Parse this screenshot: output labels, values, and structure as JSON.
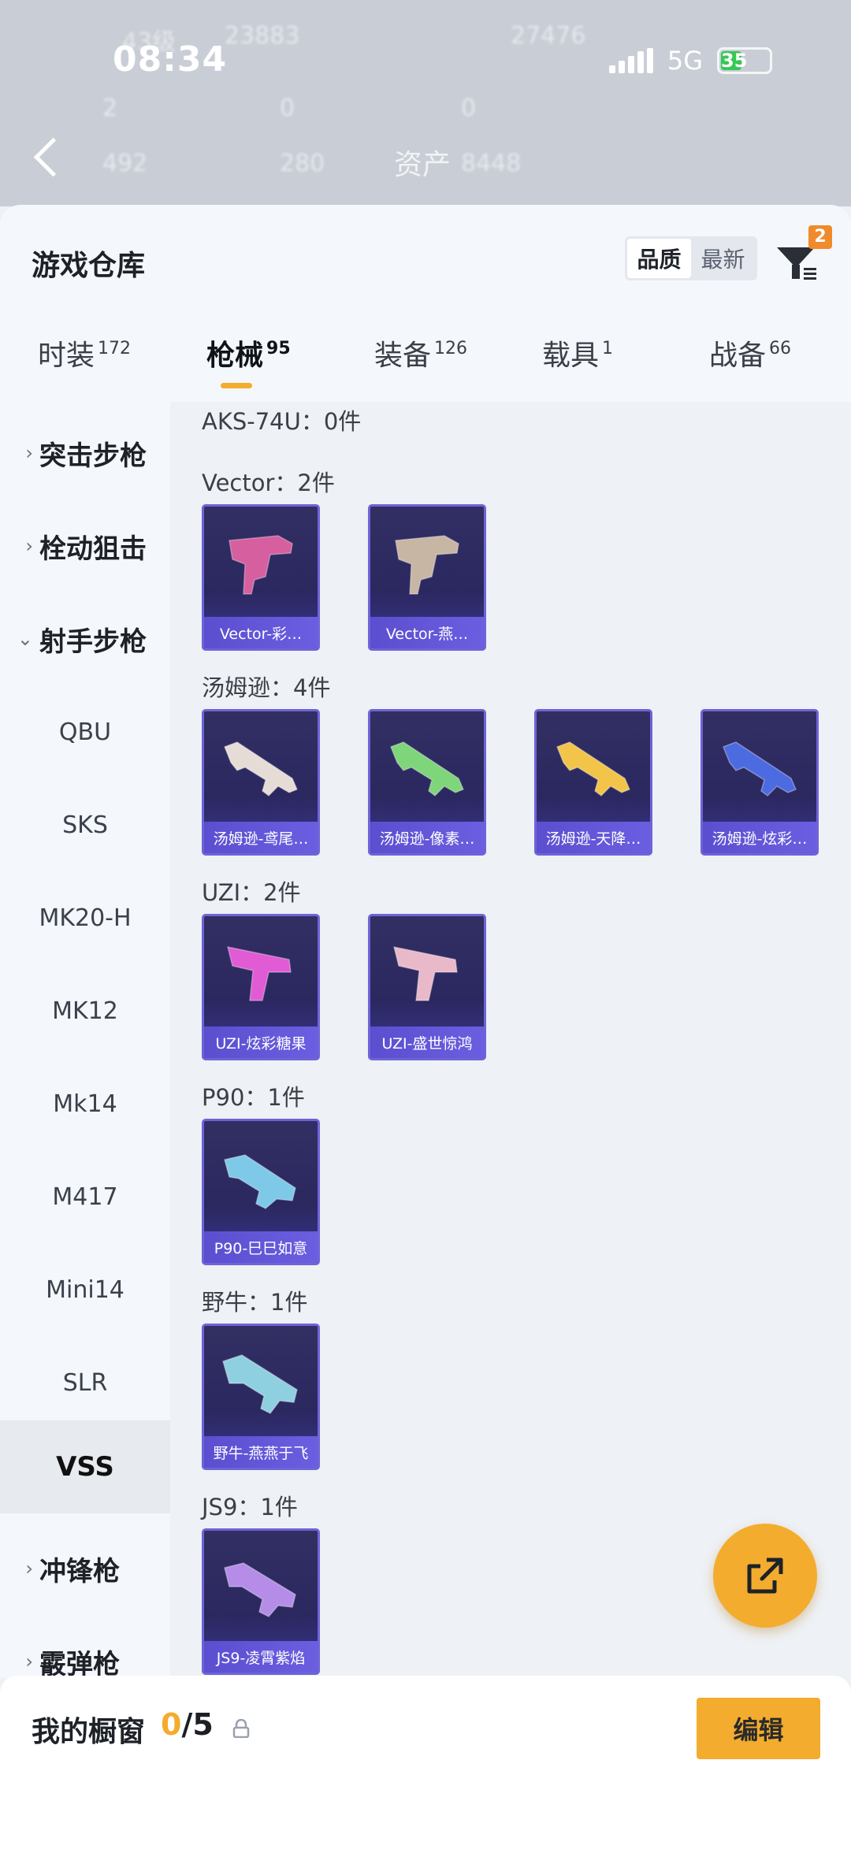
{
  "status_bar": {
    "time": "08:34",
    "network": "5G",
    "battery": "35"
  },
  "backdrop": {
    "ghost_texts": [
      "43级",
      "23883",
      "27476",
      "2",
      "0",
      "0",
      "492",
      "280",
      "资产",
      "8448"
    ]
  },
  "sheet": {
    "title": "游戏仓库",
    "sort_options": [
      "品质",
      "最新"
    ],
    "filter_badge": "2"
  },
  "tabs": [
    {
      "label": "时装",
      "count": "172"
    },
    {
      "label": "枪械",
      "count": "95"
    },
    {
      "label": "装备",
      "count": "126"
    },
    {
      "label": "载具",
      "count": "1"
    },
    {
      "label": "战备",
      "count": "66"
    }
  ],
  "sidebar": {
    "categories": [
      "突击步枪",
      "栓动狙击",
      "射手步枪",
      "冲锋枪",
      "霰弹枪"
    ],
    "subitems": [
      "QBU",
      "SKS",
      "MK20-H",
      "MK12",
      "Mk14",
      "M417",
      "Mini14",
      "SLR",
      "VSS"
    ]
  },
  "groups": [
    {
      "title": "AKS-74U：0件",
      "items": []
    },
    {
      "title": "Vector：2件",
      "items": [
        "Vector-彩…",
        "Vector-燕…"
      ]
    },
    {
      "title": "汤姆逊：4件",
      "items": [
        "汤姆逊-鸢尾…",
        "汤姆逊-像素…",
        "汤姆逊-天降…",
        "汤姆逊-炫彩…"
      ]
    },
    {
      "title": "UZI：2件",
      "items": [
        "UZI-炫彩糖果",
        "UZI-盛世惊鸿"
      ]
    },
    {
      "title": "P90：1件",
      "items": [
        "P90-巳巳如意"
      ]
    },
    {
      "title": "野牛：1件",
      "items": [
        "野牛-燕燕于飞"
      ]
    },
    {
      "title": "JS9：1件",
      "items": [
        "JS9-凌霄紫焰"
      ]
    }
  ],
  "bottom_bar": {
    "label": "我的橱窗",
    "current": "0",
    "total": "/5",
    "edit_label": "编辑"
  },
  "colors": {
    "accent": "#f3ac2e",
    "card_border": "#6f63d8",
    "gun_tints": [
      "#d65fa0",
      "#c8b6a4",
      "#e6dcd6",
      "#7fd57a",
      "#f2c54a",
      "#4c6be0",
      "#e15bd5",
      "#e9b9c9",
      "#7fc9e8",
      "#8fd0e0",
      "#b58de8"
    ]
  }
}
